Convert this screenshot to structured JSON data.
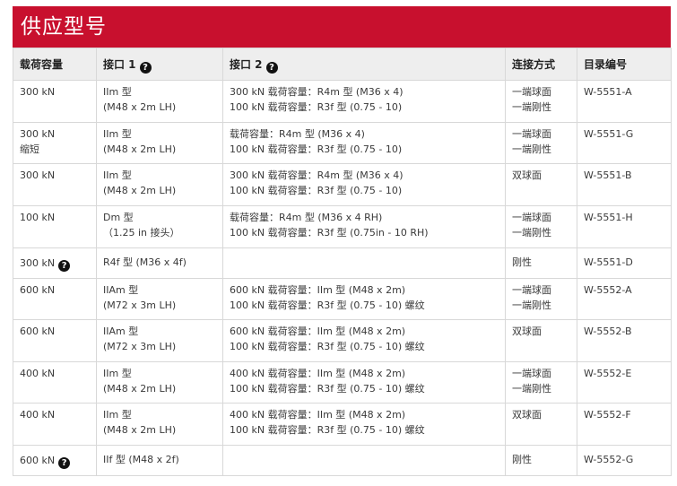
{
  "banner": {
    "title": "供应型号"
  },
  "table": {
    "headers": [
      "载荷容量",
      "接口 1",
      "接口 2",
      "连接方式",
      "目录编号"
    ],
    "rows": [
      {
        "capacity": [
          "300 kN"
        ],
        "cap_help": false,
        "if1": [
          "IIm 型",
          "(M48 x 2m LH)"
        ],
        "if2": [
          "300 kN 载荷容量：R4m 型 (M36 x 4)",
          "100 kN 载荷容量：R3f 型 (0.75 - 10)"
        ],
        "conn": [
          "一端球面",
          "一端刚性"
        ],
        "cat": "W-5551-A",
        "h": 47
      },
      {
        "capacity": [
          "300 kN",
          "缩短"
        ],
        "cap_help": false,
        "if1": [
          "IIm 型",
          "(M48 x 2m LH)"
        ],
        "if2": [
          "载荷容量：R4m 型 (M36 x 4)",
          "100 kN 载荷容量：R3f 型 (0.75 - 10)"
        ],
        "conn": [
          "一端球面",
          "一端刚性"
        ],
        "cat": "W-5551-G",
        "h": 46
      },
      {
        "capacity": [
          "300 kN"
        ],
        "cap_help": false,
        "if1": [
          "IIm 型",
          "(M48 x 2m LH)"
        ],
        "if2": [
          "300 kN 载荷容量：R4m 型 (M36 x 4)",
          "100 kN 载荷容量：R3f 型 (0.75 - 10)"
        ],
        "conn": [
          "双球面"
        ],
        "cat": "W-5551-B",
        "h": 47
      },
      {
        "capacity": [
          "100 kN"
        ],
        "cap_help": false,
        "if1": [
          "Dm 型",
          "（1.25 in 接头）"
        ],
        "if2": [
          "载荷容量：R4m 型 (M36 x 4 RH)",
          "100 kN 载荷容量：R3f 型 (0.75in - 10 RH)"
        ],
        "conn": [
          "一端球面",
          "一端刚性"
        ],
        "cat": "W-5551-H",
        "h": 47
      },
      {
        "capacity": [
          "300 kN"
        ],
        "cap_help": true,
        "if1": [
          "R4f 型 (M36 x 4f)"
        ],
        "if2": [],
        "conn": [
          "刚性"
        ],
        "cat": "W-5551-D",
        "h": 34
      },
      {
        "capacity": [
          "600 kN"
        ],
        "cap_help": false,
        "if1": [
          "IIAm 型",
          "(M72 x 3m LH)"
        ],
        "if2": [
          "600 kN 载荷容量：IIm 型 (M48 x 2m)",
          "100 kN 载荷容量：R3f 型 (0.75 - 10) 螺纹"
        ],
        "conn": [
          "一端球面",
          "一端刚性"
        ],
        "cat": "W-5552-A",
        "h": 46
      },
      {
        "capacity": [
          "600 kN"
        ],
        "cap_help": false,
        "if1": [
          "IIAm 型",
          "(M72 x 3m LH)"
        ],
        "if2": [
          "600 kN 载荷容量：IIm 型 (M48 x 2m)",
          "100 kN 载荷容量：R3f 型 (0.75 - 10) 螺纹"
        ],
        "conn": [
          "双球面"
        ],
        "cat": "W-5552-B",
        "h": 47
      },
      {
        "capacity": [
          "400 kN"
        ],
        "cap_help": false,
        "if1": [
          "IIm 型",
          "(M48 x 2m LH)"
        ],
        "if2": [
          "400 kN 载荷容量：IIm 型 (M48 x 2m)",
          "100 kN 载荷容量：R3f 型 (0.75 - 10) 螺纹"
        ],
        "conn": [
          "一端球面",
          "一端刚性"
        ],
        "cat": "W-5552-E",
        "h": 46
      },
      {
        "capacity": [
          "400 kN"
        ],
        "cap_help": false,
        "if1": [
          "IIm 型",
          "(M48 x 2m LH)"
        ],
        "if2": [
          "400 kN 载荷容量：IIm 型 (M48 x 2m)",
          "100 kN 载荷容量：R3f 型 (0.75 - 10) 螺纹"
        ],
        "conn": [
          "双球面"
        ],
        "cat": "W-5552-F",
        "h": 47
      },
      {
        "capacity": [
          "600 kN"
        ],
        "cap_help": true,
        "if1": [
          "IIf 型 (M48 x 2f)"
        ],
        "if2": [],
        "conn": [
          "刚性"
        ],
        "cat": "W-5552-G",
        "h": 34
      }
    ]
  }
}
